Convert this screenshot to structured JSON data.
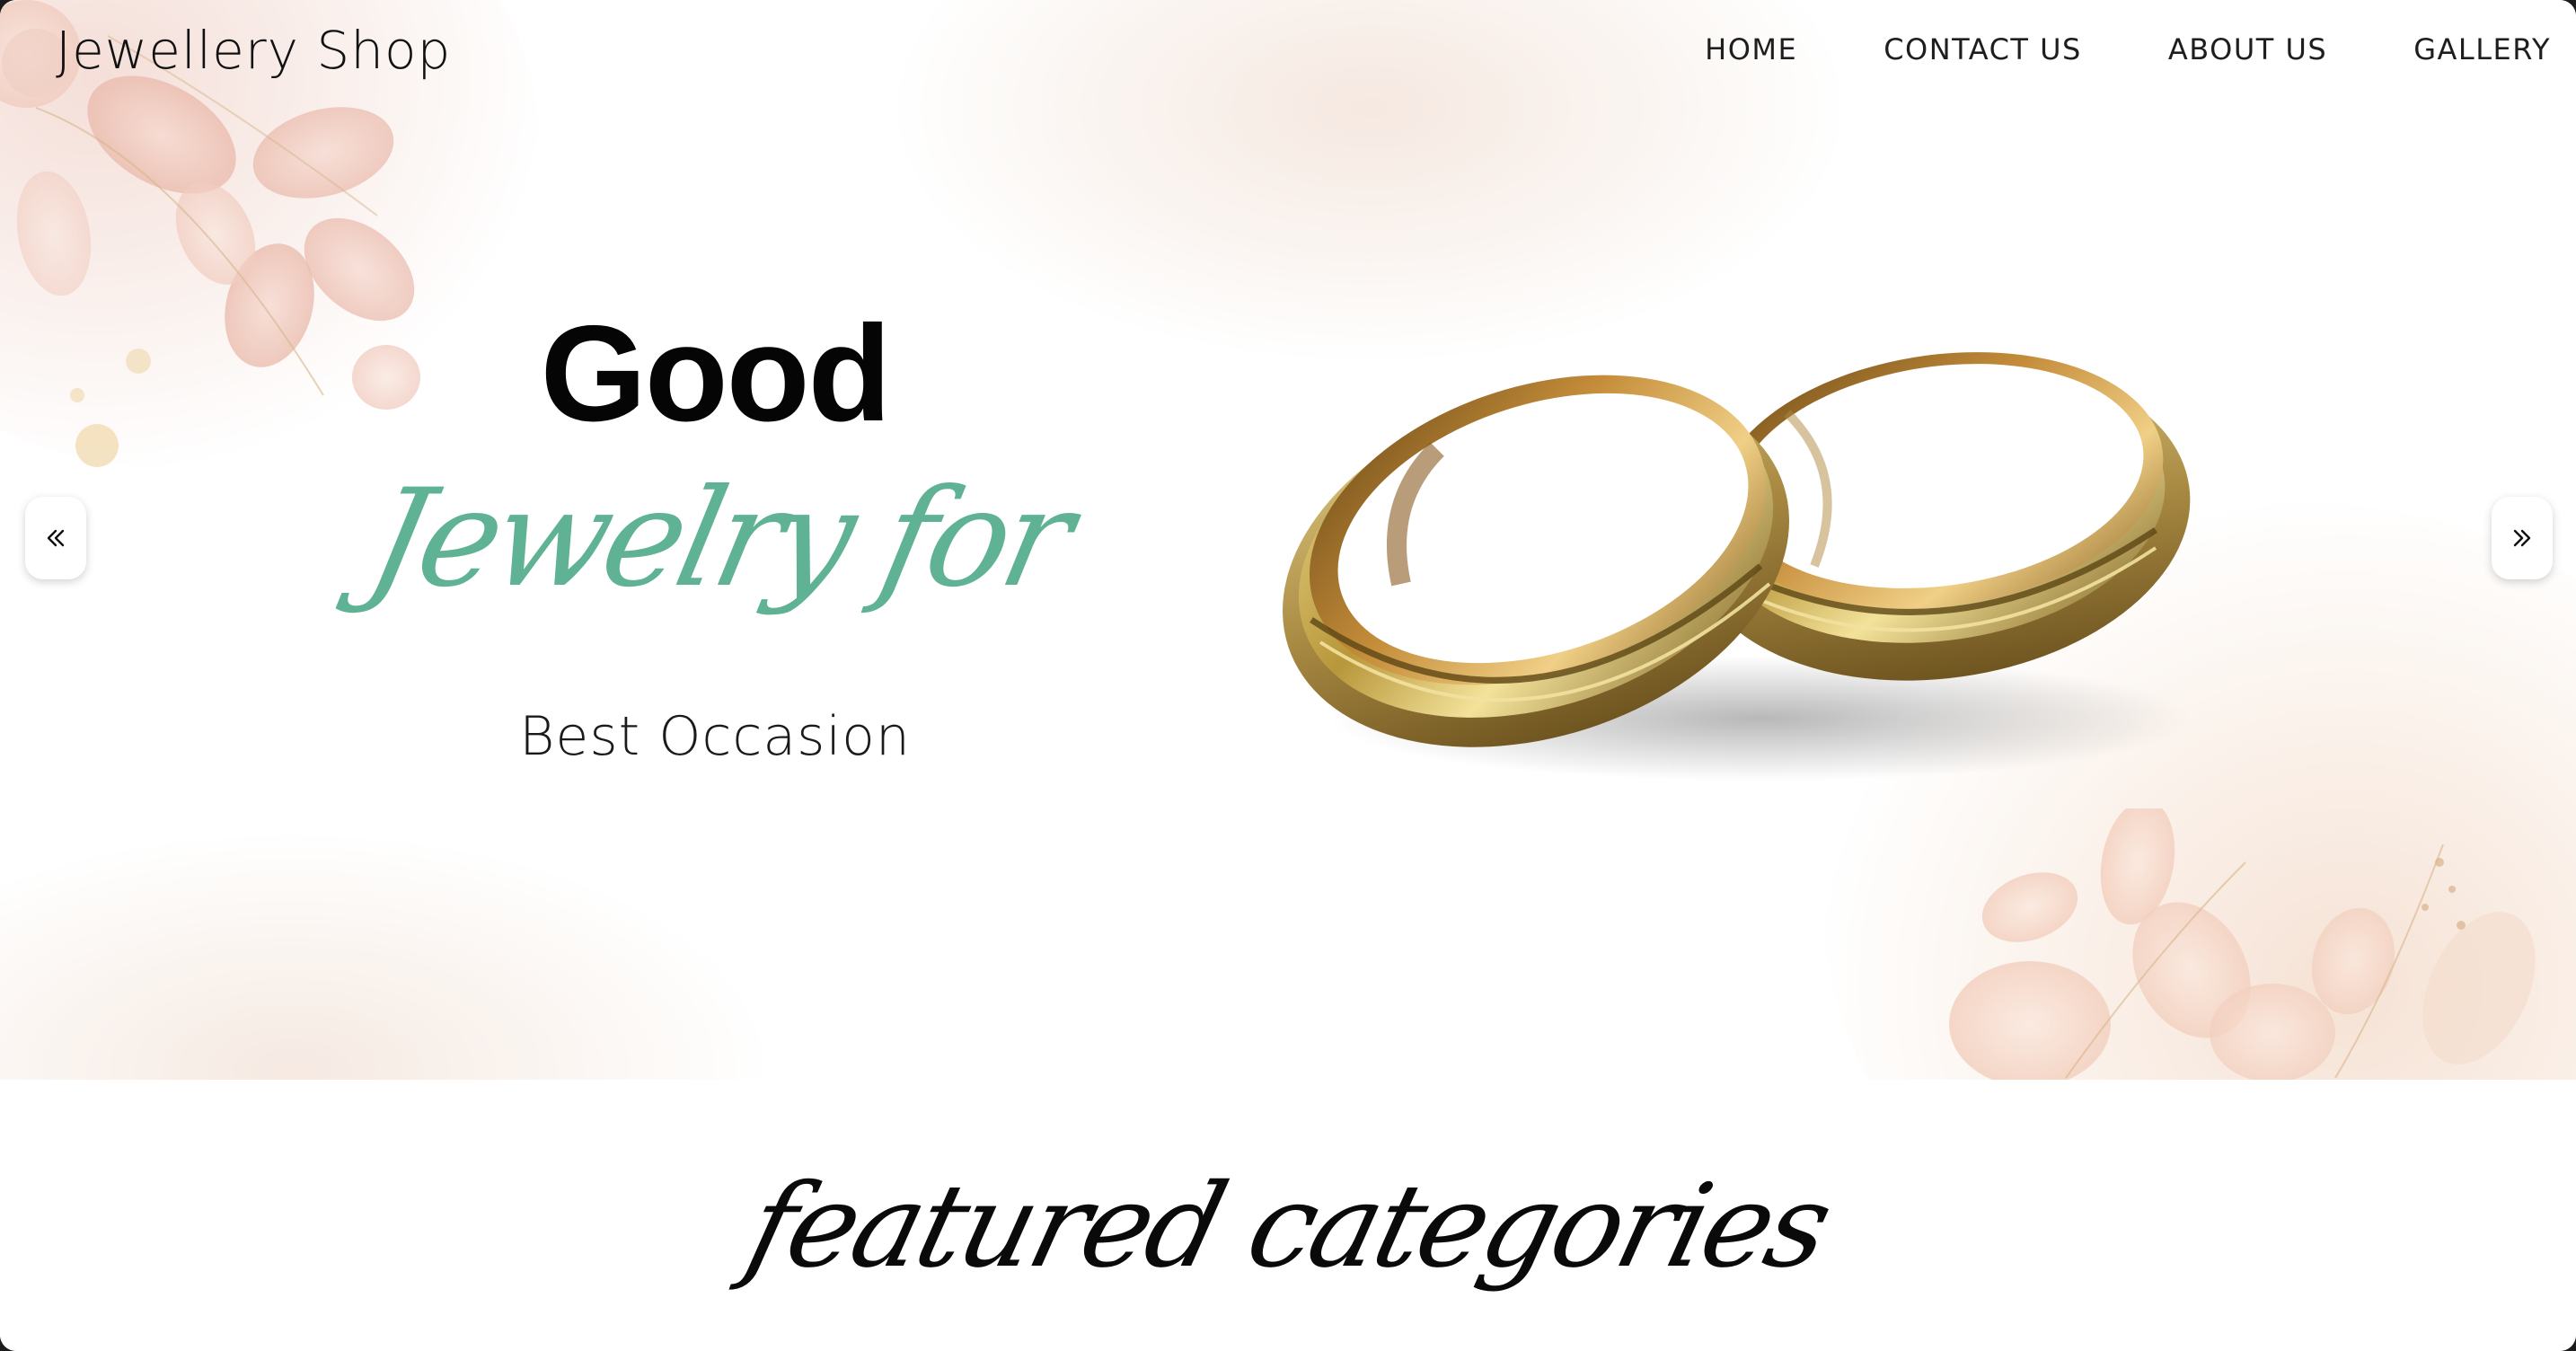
{
  "header": {
    "brand": "Jewellery Shop",
    "nav": [
      {
        "label": "HOME"
      },
      {
        "label": "CONTACT US"
      },
      {
        "label": "ABOUT US"
      },
      {
        "label": "GALLERY"
      }
    ]
  },
  "hero": {
    "line1": "Good",
    "line2": "Jewelry for",
    "line3": "Best Occasion",
    "image": "gold-wedding-rings",
    "prev_icon": "double-chevron-left-icon",
    "next_icon": "double-chevron-right-icon"
  },
  "featured": {
    "title": "featured categories"
  },
  "colors": {
    "accent_green": "#5fb394",
    "text_dark": "#111111",
    "ring_gold": "#b89a3c",
    "floral_pink": "#eec4b6"
  }
}
